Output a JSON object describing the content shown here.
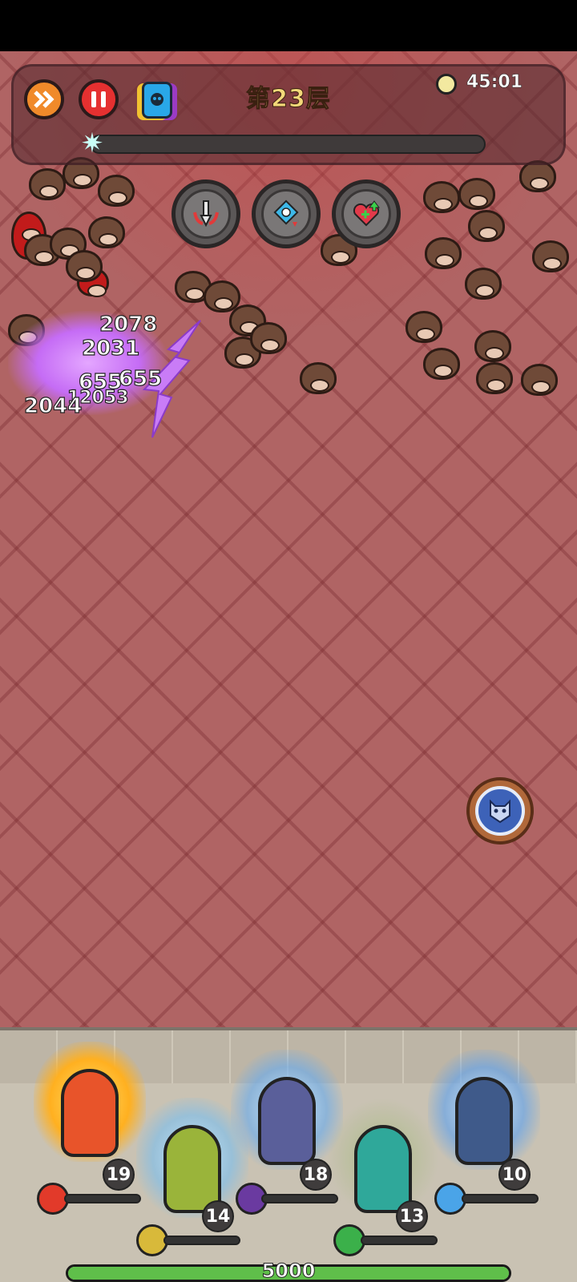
{
  "hud": {
    "floor_title": "第23层",
    "timer": "45:01",
    "wave_progress": 0.0,
    "speed_button_icon": "fast-forward-icon",
    "pause_button_icon": "pause-icon",
    "card_button_icon": "skill-card-icon"
  },
  "buffs": [
    {
      "icon": "attack-boost-icon"
    },
    {
      "icon": "cooldown-reduce-icon"
    },
    {
      "icon": "heal-boost-icon"
    }
  ],
  "damage_numbers": [
    "2078",
    "2031",
    "655",
    "655",
    "12053",
    "2044"
  ],
  "boss_skill_icon": "demon-mask-icon",
  "heroes": [
    {
      "name": "fire-hero",
      "level": "19",
      "element_icon": "fire-ring-icon",
      "element_color": "#e23a2a",
      "hp": 0.0
    },
    {
      "name": "thunder-hero",
      "level": "14",
      "element_icon": "lightning-icon",
      "element_color": "#d8b93a",
      "hp": 0.0
    },
    {
      "name": "shadow-hero",
      "level": "18",
      "element_icon": "slash-icon",
      "element_color": "#6a3aa0",
      "hp": 0.0
    },
    {
      "name": "wind-hero",
      "level": "13",
      "element_icon": "tornado-icon",
      "element_color": "#3bb04a",
      "hp": 0.0
    },
    {
      "name": "ice-hero",
      "level": "10",
      "element_icon": "ice-crystal-icon",
      "element_color": "#4aa4e8",
      "hp": 0.0
    }
  ],
  "wall_hp_text": "5000",
  "wall_hp": 1.0,
  "colors": {
    "arena": "#b06464",
    "hero_bar_fill": "#7cc8e6",
    "wall_hp_fill": "#5fbf4a"
  }
}
